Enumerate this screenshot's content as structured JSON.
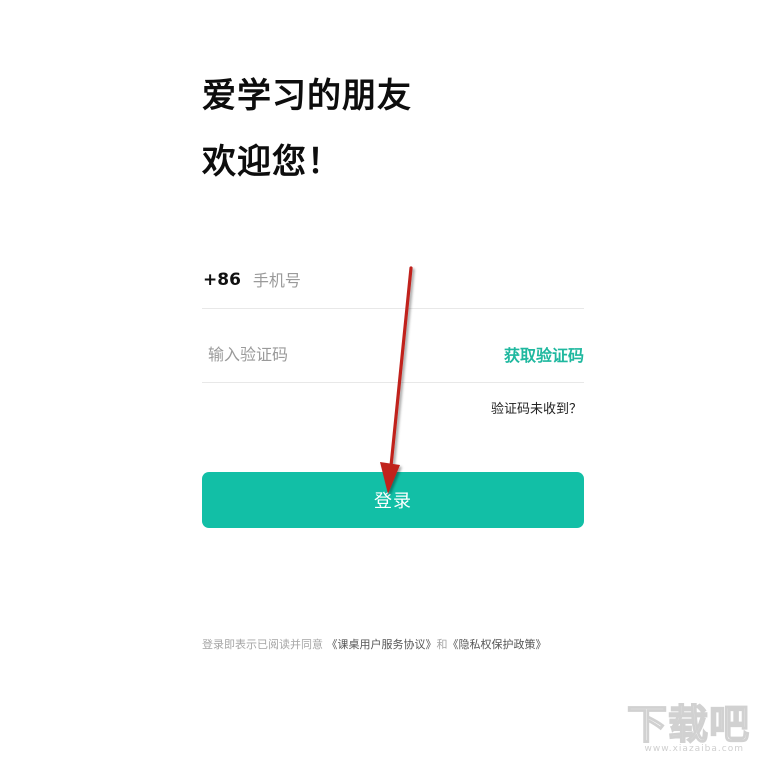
{
  "header": {
    "line1": "爱学习的朋友",
    "line2": "欢迎您！"
  },
  "phone": {
    "country_code": "+86",
    "placeholder": "手机号",
    "value": ""
  },
  "verification": {
    "placeholder": "输入验证码",
    "value": "",
    "get_code_label": "获取验证码",
    "not_received_label": "验证码未收到？"
  },
  "login": {
    "button_label": "登录"
  },
  "agreement": {
    "prefix": "登录即表示已阅读并同意",
    "service_link": "《课桌用户服务协议》",
    "joiner": "和",
    "privacy_link": "《隐私权保护政策》"
  },
  "watermark": {
    "brand": "下载吧",
    "url": "www.xiazaiba.com"
  },
  "colors": {
    "accent": "#12bfa6",
    "link_green": "#1fb89f",
    "annotation_arrow": "#c0201f"
  },
  "icons": {
    "annotation": "red-arrow-icon"
  }
}
